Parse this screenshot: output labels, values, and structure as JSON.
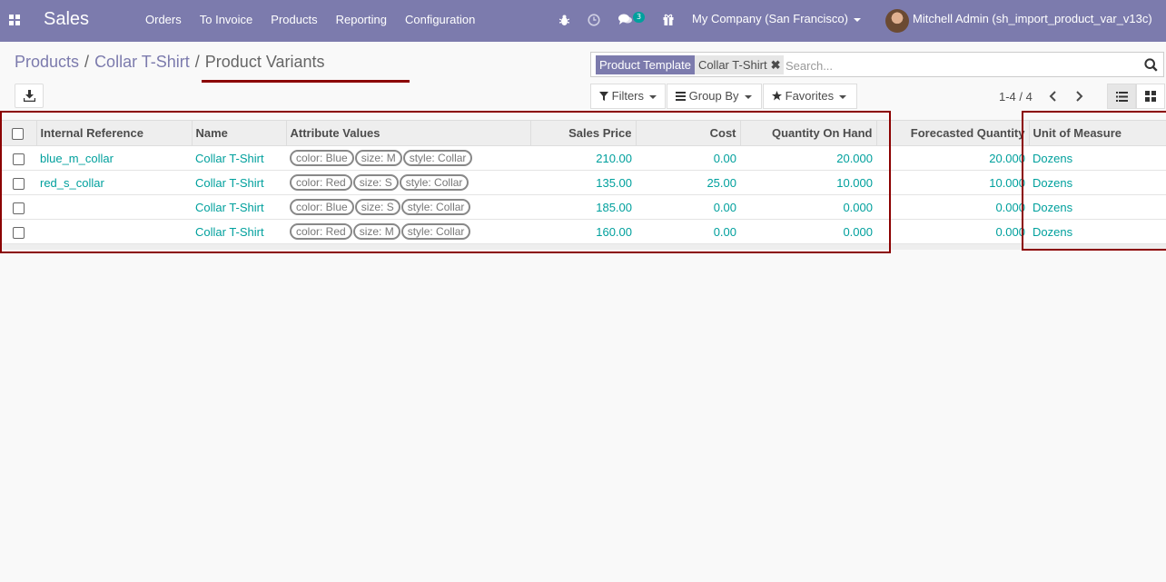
{
  "navbar": {
    "app_name": "Sales",
    "menu": [
      "Orders",
      "To Invoice",
      "Products",
      "Reporting",
      "Configuration"
    ],
    "message_count": "3",
    "company": "My Company (San Francisco)",
    "user": "Mitchell Admin (sh_import_product_var_v13c)"
  },
  "breadcrumb": {
    "items": [
      "Products",
      "Collar T-Shirt"
    ],
    "separator": "/",
    "current": "Product Variants"
  },
  "search": {
    "facet_label": "Product Template",
    "facet_value": "Collar T-Shirt",
    "facet_remove": "✖",
    "placeholder": "Search..."
  },
  "filters": {
    "filters": "Filters",
    "group_by": "Group By",
    "favorites": "Favorites"
  },
  "pager": {
    "text": "1-4 / 4"
  },
  "table": {
    "columns": [
      "Internal Reference",
      "Name",
      "Attribute Values",
      "Sales Price",
      "Cost",
      "Quantity On Hand",
      "Forecasted Quantity",
      "Unit of Measure"
    ],
    "rows": [
      {
        "ref": "blue_m_collar",
        "name": "Collar T-Shirt",
        "attrs": [
          "color: Blue",
          "size: M",
          "style: Collar"
        ],
        "price": "210.00",
        "cost": "0.00",
        "qty": "20.000",
        "forecast": "20.000",
        "uom": "Dozens"
      },
      {
        "ref": "red_s_collar",
        "name": "Collar T-Shirt",
        "attrs": [
          "color: Red",
          "size: S",
          "style: Collar"
        ],
        "price": "135.00",
        "cost": "25.00",
        "qty": "10.000",
        "forecast": "10.000",
        "uom": "Dozens"
      },
      {
        "ref": "",
        "name": "Collar T-Shirt",
        "attrs": [
          "color: Blue",
          "size: S",
          "style: Collar"
        ],
        "price": "185.00",
        "cost": "0.00",
        "qty": "0.000",
        "forecast": "0.000",
        "uom": "Dozens"
      },
      {
        "ref": "",
        "name": "Collar T-Shirt",
        "attrs": [
          "color: Red",
          "size: M",
          "style: Collar"
        ],
        "price": "160.00",
        "cost": "0.00",
        "qty": "0.000",
        "forecast": "0.000",
        "uom": "Dozens"
      }
    ]
  },
  "colors": {
    "navbar": "#7c7bad",
    "link": "#00a09d",
    "annotation": "#8b0000"
  }
}
